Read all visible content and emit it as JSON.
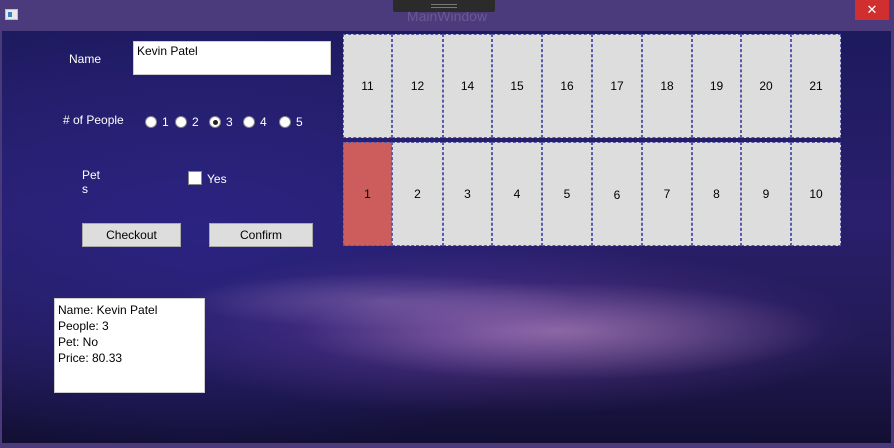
{
  "window": {
    "title": "MainWindow",
    "close_glyph": "✕",
    "accent_color": "#4b3a7c",
    "close_color": "#d12f2f"
  },
  "form": {
    "name_label": "Name",
    "name_value": "Kevin Patel",
    "people_label": "# of People",
    "people_options": [
      "1",
      "2",
      "3",
      "4",
      "5"
    ],
    "people_selected": "3",
    "pets_label_line1": "Pet",
    "pets_label_line2": "s",
    "pet_checkbox_label": "Yes",
    "pet_checked": false,
    "checkout_label": "Checkout",
    "confirm_label": "Confirm"
  },
  "summary": {
    "name_line": "Name: Kevin Patel",
    "people_line": "People: 3",
    "pet_line": "Pet: No",
    "price_line": "Price: 80.33"
  },
  "seats": {
    "top_row": [
      "11",
      "12",
      "14",
      "15",
      "16",
      "17",
      "18",
      "19",
      "20",
      "21"
    ],
    "bottom_row": [
      "1",
      "2",
      "3",
      "4",
      "5",
      "6",
      "7",
      "8",
      "9",
      "10"
    ],
    "taken": [
      "1"
    ],
    "seat_color": "#dddddd",
    "taken_color": "#cd5c5c"
  }
}
